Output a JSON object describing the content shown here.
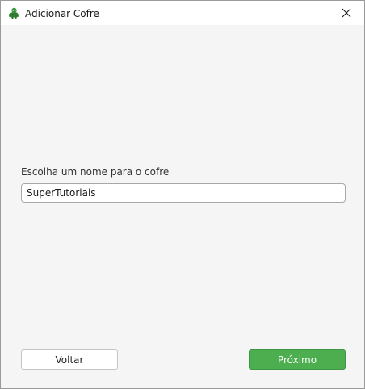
{
  "window": {
    "title": "Adicionar Cofre",
    "app_icon": "cryptomator-robot-icon",
    "close_icon": "close-icon"
  },
  "form": {
    "label": "Escolha um nome para o cofre",
    "vault_name_value": "SuperTutoriais"
  },
  "buttons": {
    "back_label": "Voltar",
    "next_label": "Próximo"
  },
  "colors": {
    "accent": "#4cae4f",
    "window_bg": "#f5f5f5",
    "titlebar_bg": "#ffffff"
  }
}
